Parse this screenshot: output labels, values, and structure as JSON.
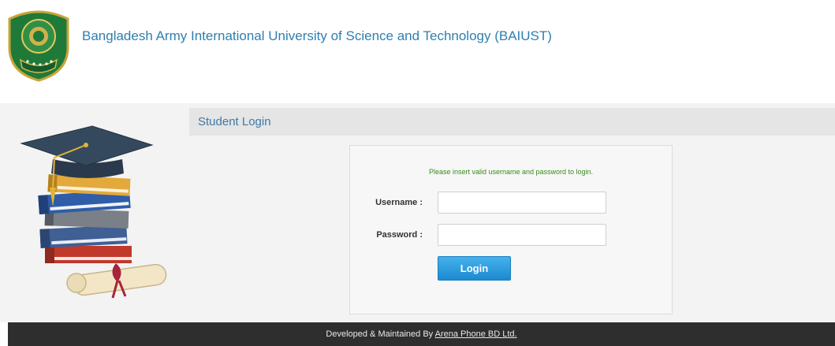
{
  "header": {
    "logo_icon": "university-crest-icon",
    "site_title": "Bangladesh Army International University of Science and Technology (BAIUST)"
  },
  "illustration": {
    "icon": "graduation-books-icon"
  },
  "login": {
    "panel_title": "Student Login",
    "message": "Please insert valid username and password to login.",
    "username_label": "Username :",
    "username_value": "",
    "password_label": "Password :",
    "password_value": "",
    "button_label": "Login"
  },
  "footer": {
    "prefix": "Developed & Maintained By ",
    "company_link": "Arena Phone BD Ltd."
  },
  "colors": {
    "accent": "#2f7fb0",
    "button": "#2a9be0",
    "footer": "#2e2e2e",
    "message": "#3a8a20"
  }
}
